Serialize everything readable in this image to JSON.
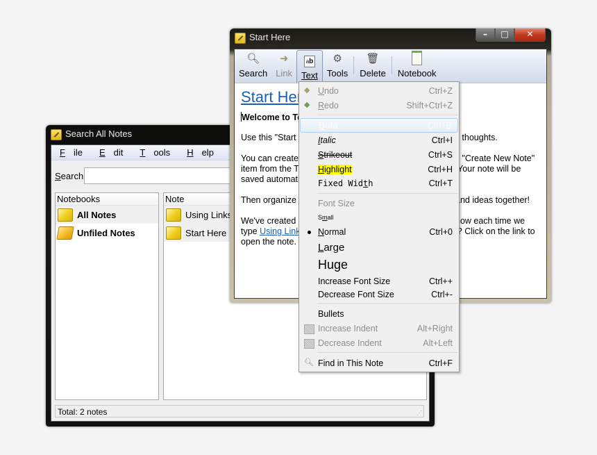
{
  "search_window": {
    "title": "Search All Notes",
    "menubar": [
      {
        "label": "File",
        "mnemonic": "F",
        "rest": "ile"
      },
      {
        "label": "Edit",
        "mnemonic": "E",
        "rest": "dit"
      },
      {
        "label": "Tools",
        "mnemonic": "T",
        "rest": "ools"
      },
      {
        "label": "Help",
        "mnemonic": "H",
        "rest": "elp"
      }
    ],
    "search": {
      "label_mnemonic": "S",
      "label_rest": "earch:",
      "value": "",
      "placeholder": ""
    },
    "notebooks": {
      "header": "Notebooks",
      "items": [
        {
          "label": "All Notes",
          "icon": "notebook-icon",
          "selected": true
        },
        {
          "label": "Unfiled Notes",
          "icon": "unfiled-notebook-icon",
          "selected": false
        }
      ]
    },
    "notes": {
      "header": "Note",
      "items": [
        {
          "label": "Using Links in Tomboy",
          "icon": "note-icon"
        },
        {
          "label": "Start Here",
          "icon": "note-icon"
        }
      ]
    },
    "status": "Total: 2 notes"
  },
  "note_window": {
    "title": "Start Here",
    "toolbar": [
      {
        "label": "Search",
        "icon": "magnifier-icon",
        "enabled": true
      },
      {
        "label": "Link",
        "icon": "link-icon",
        "enabled": false
      },
      {
        "label": "Text",
        "icon": "text-format-icon",
        "enabled": true,
        "active": true
      },
      {
        "label": "Tools",
        "icon": "gears-icon",
        "enabled": true
      },
      {
        "label": "Delete",
        "icon": "trash-icon",
        "enabled": true
      },
      {
        "label": "Notebook",
        "icon": "notebook-icon",
        "enabled": true
      }
    ],
    "content": {
      "heading": "Start Here",
      "line1": "Welcome to Tomboy!",
      "line2": "Use this \"Start Here\" note to begin organizing your ideas and thoughts.",
      "para2_l1": "You can create new notes to hold your ideas by selecting the \"Create New Note\"",
      "para2_l2": "item from the Tomboy menu in your GNOME Panel. Your note will be",
      "para2_l3": "saved automatically.",
      "para3": "Then organize the notes you create by linking related notes and ideas together!",
      "para4_l1_a": "We've created a note called ",
      "para4_link": "Using Links in Tomboy",
      "para4_l1_b": ".  Notice how each time we",
      "para4_l2_a": "type ",
      "para4_l2_b": " it automatically gets underlined?  Click on the link to",
      "para4_l3": "open the note.",
      "visible_left": {
        "line1": "Welcome to To",
        "line2": "Use this \"Start H",
        "p2l1": "You can create r",
        "p2l2": "item from the T",
        "p2l3": "saved automatic",
        "p3": "Then organize t",
        "p4l1": "We've created a",
        "p4l2_a": "type ",
        "p4l2_link": "Using Links",
        "p4l3": "open the note."
      },
      "visible_right": {
        "line2": "d thoughts.",
        "p2l1": "e \"Create New Note\"",
        "p2l2": "Your note will be",
        "p3": "and ideas together!",
        "p4l1": "how each time we",
        "p4l2": "l?  Click on the link to"
      }
    }
  },
  "text_menu": {
    "items": [
      {
        "id": "undo",
        "mn": "U",
        "rest": "ndo",
        "accel": "Ctrl+Z",
        "enabled": false,
        "icon": "undo-icon"
      },
      {
        "id": "redo",
        "mn": "R",
        "rest": "edo",
        "accel": "Shift+Ctrl+Z",
        "enabled": false,
        "icon": "redo-icon"
      },
      {
        "id": "bold",
        "mn": "B",
        "rest": "old",
        "accel": "Ctrl+B",
        "hovered": true
      },
      {
        "id": "italic",
        "mn": "I",
        "rest": "talic",
        "accel": "Ctrl+I"
      },
      {
        "id": "strikeout",
        "mn": "S",
        "rest": "trikeout",
        "accel": "Ctrl+S"
      },
      {
        "id": "highlight",
        "mn": "H",
        "rest": "ighlight",
        "accel": "Ctrl+H"
      },
      {
        "id": "fixed-width",
        "pre": "Fixed Wid",
        "mn": "t",
        "rest": "h",
        "accel": "Ctrl+T"
      },
      {
        "id": "font-size-header",
        "label": "Font Size",
        "enabled": false
      },
      {
        "id": "small",
        "pre": "S",
        "mn": "m",
        "rest": "all"
      },
      {
        "id": "normal",
        "mn": "N",
        "rest": "ormal",
        "accel": "Ctrl+0",
        "checked": true
      },
      {
        "id": "large",
        "mn": "L",
        "rest": "arge"
      },
      {
        "id": "huge",
        "label": "Huge"
      },
      {
        "id": "increase-font",
        "label": "Increase Font Size",
        "accel": "Ctrl++"
      },
      {
        "id": "decrease-font",
        "label": "Decrease Font Size",
        "accel": "Ctrl+-"
      },
      {
        "id": "bullets",
        "label": "Bullets"
      },
      {
        "id": "increase-indent",
        "label": "Increase Indent",
        "accel": "Alt+Right",
        "enabled": false,
        "icon": "indent-icon"
      },
      {
        "id": "decrease-indent",
        "label": "Decrease Indent",
        "accel": "Alt+Left",
        "enabled": false,
        "icon": "outdent-icon"
      },
      {
        "id": "find",
        "label": "Find in This Note",
        "accel": "Ctrl+F",
        "icon": "find-icon"
      }
    ]
  },
  "window_controls": {
    "minimize": "–",
    "maximize": "□",
    "close": "✕"
  }
}
